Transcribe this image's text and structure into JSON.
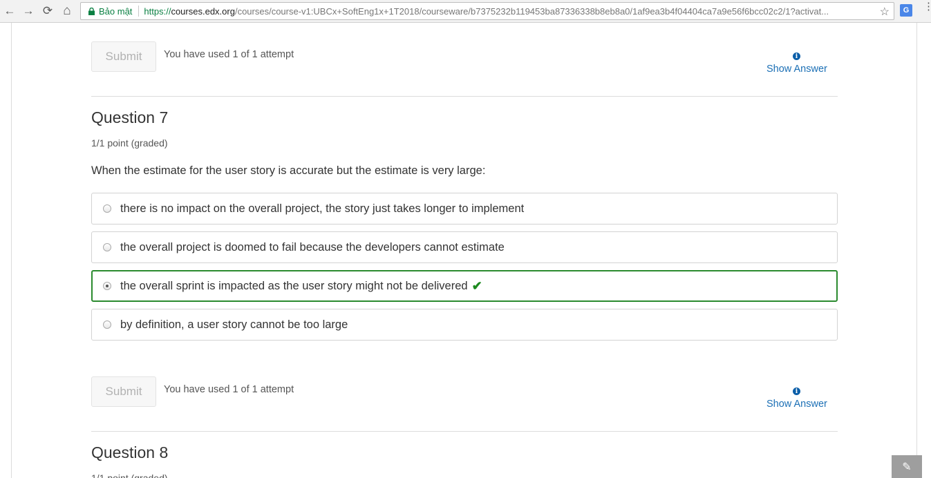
{
  "browser": {
    "back_icon": "←",
    "forward_icon": "→",
    "reload_icon": "⟳",
    "home_icon": "⌂",
    "secure_label": "Bảo mật",
    "url_scheme": "https://",
    "url_host": "courses.edx.org",
    "url_path": "/courses/course-v1:UBCx+SoftEng1x+1T2018/courseware/b7375232b119453ba87336338b8eb8a0/1af9ea3b4f04404ca7a9e56f6bcc02c2/1?activat...",
    "star_icon": "☆",
    "translate_icon": "G",
    "menu_icon": "⋮"
  },
  "top_section": {
    "submit_label": "Submit",
    "attempts_text": "You have used 1 of 1 attempt",
    "show_answer_label": "Show Answer",
    "info_icon": "i"
  },
  "question7": {
    "title": "Question 7",
    "points": "1/1 point (graded)",
    "prompt": "When the estimate for the user story is accurate but the estimate is very large:",
    "choices": [
      {
        "label": "there is no impact on the overall project, the story just takes longer to implement",
        "selected": false,
        "correct": false
      },
      {
        "label": "the overall project is doomed to fail because the developers cannot estimate",
        "selected": false,
        "correct": false
      },
      {
        "label": "the overall sprint is impacted as the user story might not be delivered",
        "selected": true,
        "correct": true
      },
      {
        "label": "by definition, a user story cannot be too large",
        "selected": false,
        "correct": false
      }
    ],
    "correct_icon": "✔",
    "submit_label": "Submit",
    "attempts_text": "You have used 1 of 1 attempt",
    "show_answer_label": "Show Answer",
    "info_icon": "i"
  },
  "question8": {
    "title": "Question 8",
    "points": "1/1 point (graded)"
  },
  "edit_icon": "✎",
  "colors": {
    "correct_border": "#2a8a2e",
    "link": "#1b6fb5",
    "secure_green": "#0b8043"
  }
}
